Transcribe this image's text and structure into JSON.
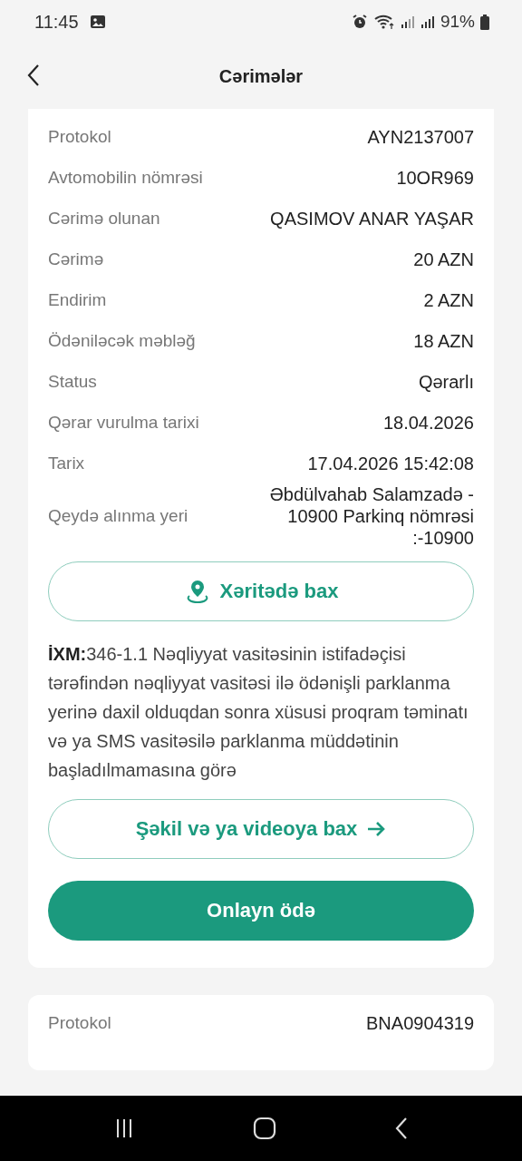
{
  "status_bar": {
    "time": "11:45",
    "battery": "91%"
  },
  "header": {
    "title": "Cərimələr"
  },
  "fines": [
    {
      "rows": [
        {
          "label": "Protokol",
          "value": "AYN2137007"
        },
        {
          "label": "Avtomobilin nömrəsi",
          "value": "10OR969"
        },
        {
          "label": "Cərimə olunan",
          "value": "QASIMOV ANAR YAŞAR"
        },
        {
          "label": "Cərimə",
          "value": "20 AZN"
        },
        {
          "label": "Endirim",
          "value": "2 AZN"
        },
        {
          "label": "Ödəniləcək məbləğ",
          "value": "18 AZN"
        },
        {
          "label": "Status",
          "value": "Qərarlı"
        },
        {
          "label": "Qərar vurulma tarixi",
          "value": "18.04.2026"
        },
        {
          "label": "Tarix",
          "value": "17.04.2026 15:42:08"
        },
        {
          "label": "Qeydə alınma yeri",
          "value": "Əbdülvahab Salamzadə - 10900 Parkinq nömrəsi :-10900"
        }
      ],
      "map_button": "Xəritədə bax",
      "description": "**İXM:**346-1.1 Nəqliyyat vasitəsinin istifadəçisi tərəfindən nəqliyyat vasitəsi ilə ödənişli parklanma yerinə daxil olduqdan sonra xüsusi proqram təminatı və ya SMS vasitəsilə parklanma müddətinin başladılmamasına görə",
      "media_button": "Şəkil və ya videoya bax",
      "pay_button": "Onlayn ödə"
    },
    {
      "rows": [
        {
          "label": "Protokol",
          "value": "BNA0904319"
        }
      ]
    }
  ]
}
